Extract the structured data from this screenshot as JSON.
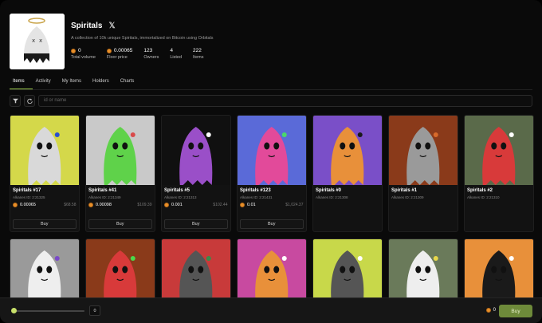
{
  "collection": {
    "title": "Spiritals",
    "x_icon": "x-logo-icon",
    "description": "A collection of 10k unique Spiritals, immortalized on Bitcoin using Orbitals",
    "stats": [
      {
        "value": "0",
        "label": "Total volume",
        "coin": true
      },
      {
        "value": "0.00065",
        "label": "Floor price",
        "coin": true
      },
      {
        "value": "123",
        "label": "Owners",
        "coin": false
      },
      {
        "value": "4",
        "label": "Listed",
        "coin": false
      },
      {
        "value": "222",
        "label": "Items",
        "coin": false
      }
    ]
  },
  "tabs": [
    "Items",
    "Activity",
    "My Items",
    "Holders",
    "Charts"
  ],
  "active_tab": "Items",
  "search": {
    "placeholder": "id or name"
  },
  "items": [
    {
      "name": "Spiritals #17",
      "aid": "Alkanes ID: 2:21325",
      "price": "0.00065",
      "usd": "$68.58",
      "buy": "Buy",
      "bg": "#d4d84a",
      "ghost": "#d9d9d9",
      "accent": "#2a4fd0"
    },
    {
      "name": "Spiritals #41",
      "aid": "Alkanes ID: 2:21349",
      "price": "0.00098",
      "usd": "$109.39",
      "buy": "Buy",
      "bg": "#c9c9c9",
      "ghost": "#5fd24a",
      "accent": "#d94a4a"
    },
    {
      "name": "Spiritals #5",
      "aid": "Alkanes ID: 2:21313",
      "price": "0.001",
      "usd": "$102.44",
      "buy": "Buy",
      "bg": "#101010",
      "ghost": "#9a4fc8",
      "accent": "#ffffff"
    },
    {
      "name": "Spiritals #123",
      "aid": "Alkanes ID: 2:21431",
      "price": "0.01",
      "usd": "$1,024.37",
      "buy": "Buy",
      "bg": "#5a6ad8",
      "ghost": "#e24a9a",
      "accent": "#4ad86a"
    },
    {
      "name": "Spiritals #0",
      "aid": "Alkanes ID: 2:21308",
      "price": null,
      "usd": null,
      "buy": null,
      "bg": "#7a4fc8",
      "ghost": "#e8903a",
      "accent": "#1a1a1a"
    },
    {
      "name": "Spiritals #1",
      "aid": "Alkanes ID: 2:21309",
      "price": null,
      "usd": null,
      "buy": null,
      "bg": "#8a3a1a",
      "ghost": "#9a9a9a",
      "accent": "#d86a2a"
    },
    {
      "name": "Spiritals #2",
      "aid": "Alkanes ID: 2:21310",
      "price": null,
      "usd": null,
      "buy": null,
      "bg": "#5a6a4a",
      "ghost": "#d83a3a",
      "accent": "#ffffff"
    }
  ],
  "items_row2": [
    {
      "bg": "#9a9a9a",
      "ghost": "#eeeeee",
      "accent": "#7a4ac8"
    },
    {
      "bg": "#8a3a1a",
      "ghost": "#d83a3a",
      "accent": "#4ad84a"
    },
    {
      "bg": "#c83a3a",
      "ghost": "#555555",
      "accent": "#3a8a4a"
    },
    {
      "bg": "#c84aa0",
      "ghost": "#e8903a",
      "accent": "#ffffff"
    },
    {
      "bg": "#c8d84a",
      "ghost": "#555555",
      "accent": "#ffffff"
    },
    {
      "bg": "#6a7a5a",
      "ghost": "#eeeeee",
      "accent": "#e8d84a"
    },
    {
      "bg": "#e8903a",
      "ghost": "#1a1a1a",
      "accent": "#ffffff"
    }
  ],
  "footer": {
    "slider_value": "0",
    "total": "0",
    "buy_label": "Buy"
  },
  "colors": {
    "accent": "#9ac84a",
    "coin": "#e8902a",
    "buy_all": "#6e8a3a"
  }
}
